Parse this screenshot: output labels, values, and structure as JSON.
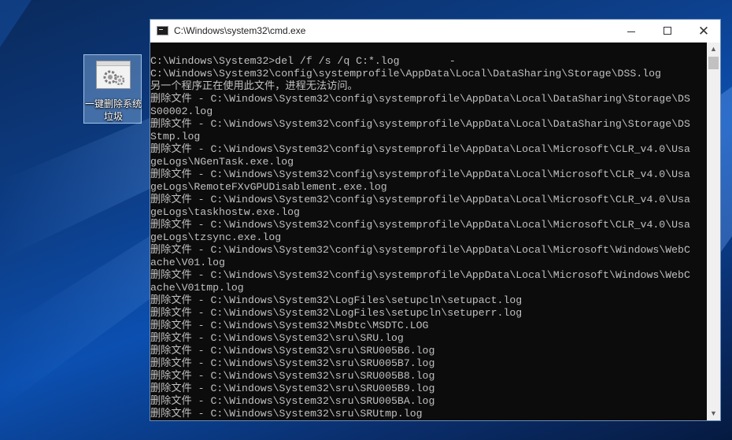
{
  "desktop": {
    "icon_label": "一键删除系统垃圾"
  },
  "window": {
    "title": "C:\\Windows\\system32\\cmd.exe",
    "minimize_symbol": "—",
    "maximize_symbol": "☐",
    "close_symbol": "✕"
  },
  "console": {
    "lines": [
      "C:\\Windows\\System32>del /f /s /q C:*.log        -",
      "C:\\Windows\\System32\\config\\systemprofile\\AppData\\Local\\DataSharing\\Storage\\DSS.log",
      "另一个程序正在使用此文件，进程无法访问。",
      "删除文件 - C:\\Windows\\System32\\config\\systemprofile\\AppData\\Local\\DataSharing\\Storage\\DS",
      "S00002.log",
      "删除文件 - C:\\Windows\\System32\\config\\systemprofile\\AppData\\Local\\DataSharing\\Storage\\DS",
      "Stmp.log",
      "删除文件 - C:\\Windows\\System32\\config\\systemprofile\\AppData\\Local\\Microsoft\\CLR_v4.0\\Usa",
      "geLogs\\NGenTask.exe.log",
      "删除文件 - C:\\Windows\\System32\\config\\systemprofile\\AppData\\Local\\Microsoft\\CLR_v4.0\\Usa",
      "geLogs\\RemoteFXvGPUDisablement.exe.log",
      "删除文件 - C:\\Windows\\System32\\config\\systemprofile\\AppData\\Local\\Microsoft\\CLR_v4.0\\Usa",
      "geLogs\\taskhostw.exe.log",
      "删除文件 - C:\\Windows\\System32\\config\\systemprofile\\AppData\\Local\\Microsoft\\CLR_v4.0\\Usa",
      "geLogs\\tzsync.exe.log",
      "删除文件 - C:\\Windows\\System32\\config\\systemprofile\\AppData\\Local\\Microsoft\\Windows\\WebC",
      "ache\\V01.log",
      "删除文件 - C:\\Windows\\System32\\config\\systemprofile\\AppData\\Local\\Microsoft\\Windows\\WebC",
      "ache\\V01tmp.log",
      "删除文件 - C:\\Windows\\System32\\LogFiles\\setupcln\\setupact.log",
      "删除文件 - C:\\Windows\\System32\\LogFiles\\setupcln\\setuperr.log",
      "删除文件 - C:\\Windows\\System32\\MsDtc\\MSDTC.LOG",
      "删除文件 - C:\\Windows\\System32\\sru\\SRU.log",
      "删除文件 - C:\\Windows\\System32\\sru\\SRU005B6.log",
      "删除文件 - C:\\Windows\\System32\\sru\\SRU005B7.log",
      "删除文件 - C:\\Windows\\System32\\sru\\SRU005B8.log",
      "删除文件 - C:\\Windows\\System32\\sru\\SRU005B9.log",
      "删除文件 - C:\\Windows\\System32\\sru\\SRU005BA.log",
      "删除文件 - C:\\Windows\\System32\\sru\\SRUtmp.log"
    ]
  },
  "scrollbar": {
    "up_symbol": "▲",
    "down_symbol": "▼"
  }
}
